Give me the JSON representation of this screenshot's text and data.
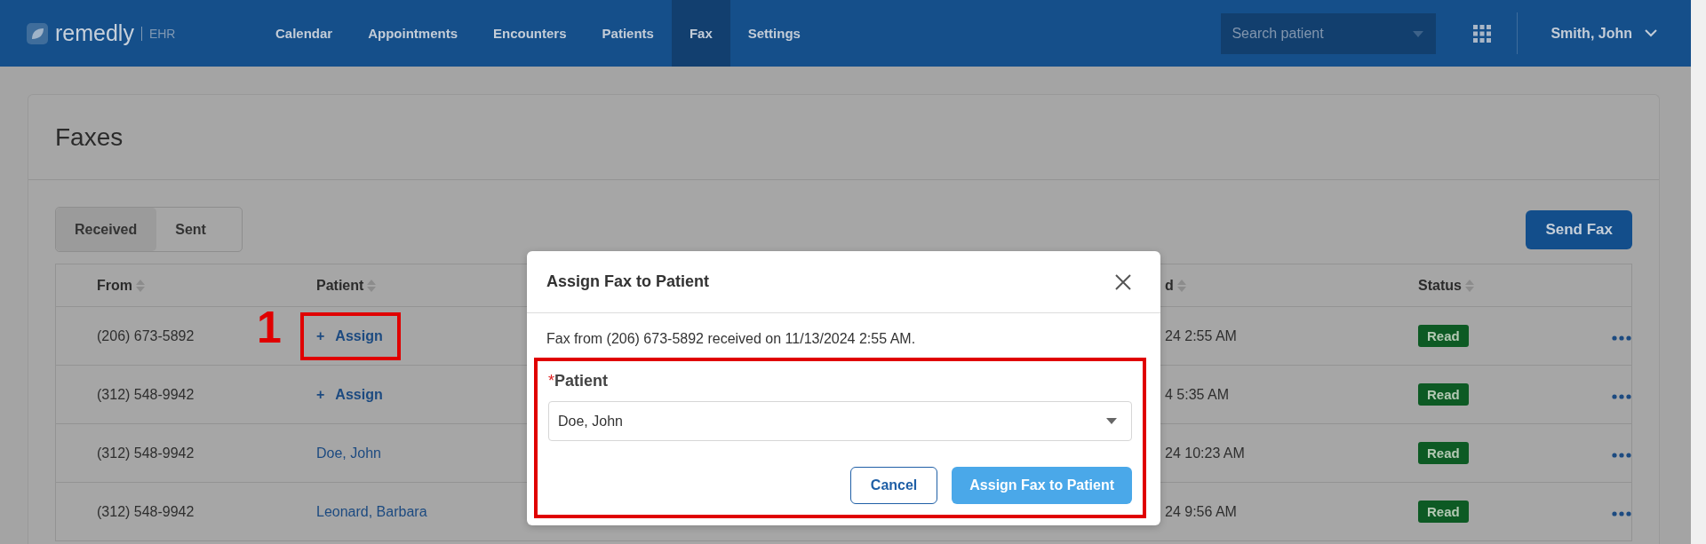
{
  "header": {
    "logo": "remedly",
    "logo_suffix": "EHR",
    "nav": [
      {
        "label": "Calendar",
        "selected": false
      },
      {
        "label": "Appointments",
        "selected": false
      },
      {
        "label": "Encounters",
        "selected": false
      },
      {
        "label": "Patients",
        "selected": false
      },
      {
        "label": "Fax",
        "selected": true
      },
      {
        "label": "Settings",
        "selected": false
      }
    ],
    "search": {
      "placeholder": "Search patient"
    },
    "user": "Smith, John"
  },
  "page": {
    "title": "Faxes",
    "tabs": [
      {
        "label": "Received",
        "selected": true
      },
      {
        "label": "Sent",
        "selected": false
      }
    ],
    "send_button": "Send Fax"
  },
  "table": {
    "columns": [
      {
        "label": "From"
      },
      {
        "label": "Patient"
      },
      {
        "label": "d"
      },
      {
        "label": "Status"
      }
    ],
    "rows": [
      {
        "from": "(206) 673-5892",
        "patient": {
          "kind": "assign",
          "plus": "+",
          "label": "Assign"
        },
        "highlighted": true,
        "step": "1",
        "received": "24 2:55 AM",
        "status": "Read"
      },
      {
        "from": "(312) 548-9942",
        "patient": {
          "kind": "assign",
          "plus": "+",
          "label": "Assign"
        },
        "highlighted": false,
        "received": "4 5:35 AM",
        "status": "Read"
      },
      {
        "from": "(312) 548-9942",
        "patient": {
          "kind": "link",
          "label": "Doe, John"
        },
        "highlighted": false,
        "received": "24 10:23 AM",
        "status": "Read"
      },
      {
        "from": "(312) 548-9942",
        "patient": {
          "kind": "link",
          "label": "Leonard, Barbara"
        },
        "highlighted": false,
        "received": "24 9:56 AM",
        "status": "Read"
      }
    ]
  },
  "modal": {
    "title": "Assign Fax to Patient",
    "message": "Fax from (206) 673-5892 received on 11/13/2024 2:55 AM.",
    "form_highlighted": true,
    "field": {
      "label": "Patient",
      "required": true,
      "required_mark": "*",
      "value": "Doe, John"
    },
    "buttons": [
      {
        "kind": "secondary",
        "label": "Cancel"
      },
      {
        "kind": "primary",
        "label": "Assign Fax to Patient"
      }
    ]
  }
}
